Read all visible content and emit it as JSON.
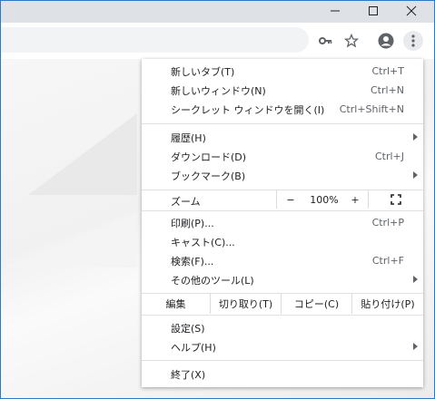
{
  "window": {
    "controls": [
      "minimize-icon",
      "maximize-icon",
      "close-icon"
    ]
  },
  "toolbar": {
    "icons": [
      "key-icon",
      "star-icon",
      "profile-icon",
      "more-vert-icon"
    ]
  },
  "menu": {
    "new_tab": {
      "label": "新しいタブ(T)",
      "shortcut": "Ctrl+T"
    },
    "new_window": {
      "label": "新しいウィンドウ(N)",
      "shortcut": "Ctrl+N"
    },
    "incognito": {
      "label": "シークレット ウィンドウを開く(I)",
      "shortcut": "Ctrl+Shift+N"
    },
    "history": {
      "label": "履歴(H)"
    },
    "downloads": {
      "label": "ダウンロード(D)",
      "shortcut": "Ctrl+J"
    },
    "bookmarks": {
      "label": "ブックマーク(B)"
    },
    "zoom": {
      "label": "ズーム",
      "minus": "−",
      "value": "100%",
      "plus": "+"
    },
    "print": {
      "label": "印刷(P)...",
      "shortcut": "Ctrl+P"
    },
    "cast": {
      "label": "キャスト(C)..."
    },
    "find": {
      "label": "検索(F)...",
      "shortcut": "Ctrl+F"
    },
    "more_tools": {
      "label": "その他のツール(L)"
    },
    "edit": {
      "label": "編集",
      "cut": "切り取り(T)",
      "copy": "コピー(C)",
      "paste": "貼り付け(P)"
    },
    "settings": {
      "label": "設定(S)"
    },
    "help": {
      "label": "ヘルプ(H)"
    },
    "exit": {
      "label": "終了(X)"
    }
  }
}
